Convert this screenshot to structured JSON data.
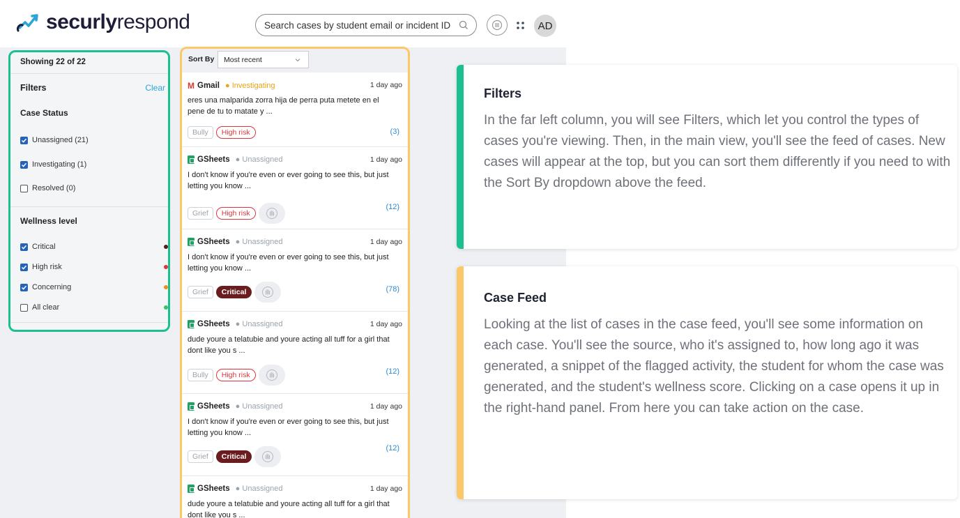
{
  "brand": {
    "name": "securly",
    "product": "respond"
  },
  "search": {
    "placeholder": "Search cases by student email or incident ID"
  },
  "user": {
    "initials": "AD"
  },
  "filters": {
    "showing": "Showing 22 of 22",
    "title": "Filters",
    "clear_label": "Clear",
    "case_status_title": "Case Status",
    "case_status": [
      {
        "label": "Unassigned (21)",
        "checked": true
      },
      {
        "label": "Investigating (1)",
        "checked": true
      },
      {
        "label": "Resolved (0)",
        "checked": false
      }
    ],
    "wellness_title": "Wellness level",
    "wellness": [
      {
        "label": "Critical",
        "checked": true,
        "color": "#5a1a1a"
      },
      {
        "label": "High risk",
        "checked": true,
        "color": "#e0353b"
      },
      {
        "label": "Concerning",
        "checked": true,
        "color": "#f08a1c"
      },
      {
        "label": "All clear",
        "checked": false,
        "color": "#34c46a"
      }
    ]
  },
  "feed": {
    "sort_label": "Sort By",
    "sort_value": "Most recent",
    "cases": [
      {
        "source": "Gmail",
        "status": "Investigating",
        "status_color": "#e8a317",
        "time": "1 day ago",
        "snippet": "eres una malparida zorra hija de perra puta metete en el pene de tu to matate y ...",
        "category": "Bully",
        "risk": "High risk",
        "count": "(3)"
      },
      {
        "source": "GSheets",
        "status": "Unassigned",
        "status_color": "#9aa2ab",
        "time": "1 day ago",
        "snippet": "I don't know if you're even or ever going to see this, but just letting you know ...",
        "category": "Grief",
        "risk": "High risk",
        "count": "(12)"
      },
      {
        "source": "GSheets",
        "status": "Unassigned",
        "status_color": "#9aa2ab",
        "time": "1 day ago",
        "snippet": "I don't know if you're even or ever going to see this, but just letting you know ...",
        "category": "Grief",
        "risk": "Critical",
        "count": "(78)"
      },
      {
        "source": "GSheets",
        "status": "Unassigned",
        "status_color": "#9aa2ab",
        "time": "1 day ago",
        "snippet": "dude youre a telatubie and youre acting all tuff for a girl that dont like you s ...",
        "category": "Bully",
        "risk": "High risk",
        "count": "(12)"
      },
      {
        "source": "GSheets",
        "status": "Unassigned",
        "status_color": "#9aa2ab",
        "time": "1 day ago",
        "snippet": "I don't know if you're even or ever going to see this, but just letting you know ...",
        "category": "Grief",
        "risk": "Critical",
        "count": "(12)"
      },
      {
        "source": "GSheets",
        "status": "Unassigned",
        "status_color": "#9aa2ab",
        "time": "1 day ago",
        "snippet": "dude youre a telatubie and youre acting all tuff for a girl that dont like you s ..."
      }
    ]
  },
  "cards": [
    {
      "title": "Filters",
      "accent": "#1cbf8f",
      "text": "In the far left column, you will see Filters, which let you control the types of cases you're viewing. Then, in the main view, you'll see the feed of cases. New cases will appear at the top, but you can sort them differently if you need to with the Sort By dropdown above the feed."
    },
    {
      "title": "Case Feed",
      "accent": "#fbc767",
      "text": "Looking at the list of cases in the case feed, you'll see some information on each case. You'll see the source, who it's assigned to, how long ago it was generated, a snippet of the flagged activity, the student for whom the case was generated, and the student's wellness score. Clicking on a case opens it up in the right-hand panel. From here you can take action on the case."
    }
  ]
}
